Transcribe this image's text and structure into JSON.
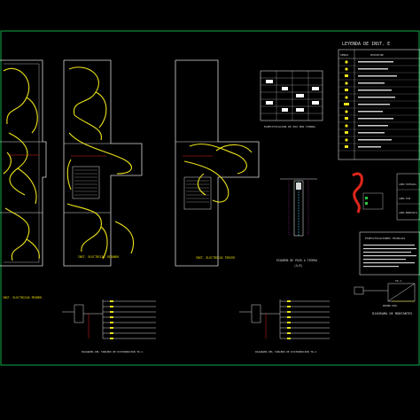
{
  "colors": {
    "background": "#000000",
    "frame_green": "#11a84a",
    "wall_white": "#d8d8d8",
    "circuit_yellow": "#ece21a",
    "accent_red": "#e0261c",
    "accent_cyan": "#35cfe8",
    "accent_magenta": "#d23bd2",
    "accent_green": "#27c93f"
  },
  "legend": {
    "title": "LEYENDA DE INST. E",
    "col_symbol": "SIMBOLO",
    "col_description": "DESCRIPCION"
  },
  "plans": {
    "plan1_title": "INST. ELECTRICAS PRIMER",
    "plan2_title": "INST. ELECTRICAS SEGUNDO",
    "plan3_title": "INST. ELECTRICAS TERCER"
  },
  "details": {
    "table_caption": "ESPECIFICACION DE POZ POR TIERRA",
    "pozo_title": "ESQUEMA DE POZO A TIERRA",
    "pozo_scale": "(S/E)",
    "box_labels": [
      "LINEA TRIFASICA",
      "LINEA FASE",
      "LINEA MONOFASICA"
    ],
    "notes_title": "ESPECIFICACIONES TECNICAS",
    "diagram2_title": "DIAGRAMA DE MONTANTES",
    "meter_label": "TD-1",
    "primer_piso": "PRIMER PISO"
  },
  "tableros": {
    "tablero1_caption": "DIAGRAMA DEL TABLERO DE DISTRIBUCION TD-1",
    "tablero2_caption": "DIAGRAMA DEL TABLERO DE DISTRIBUCION TD-2"
  }
}
